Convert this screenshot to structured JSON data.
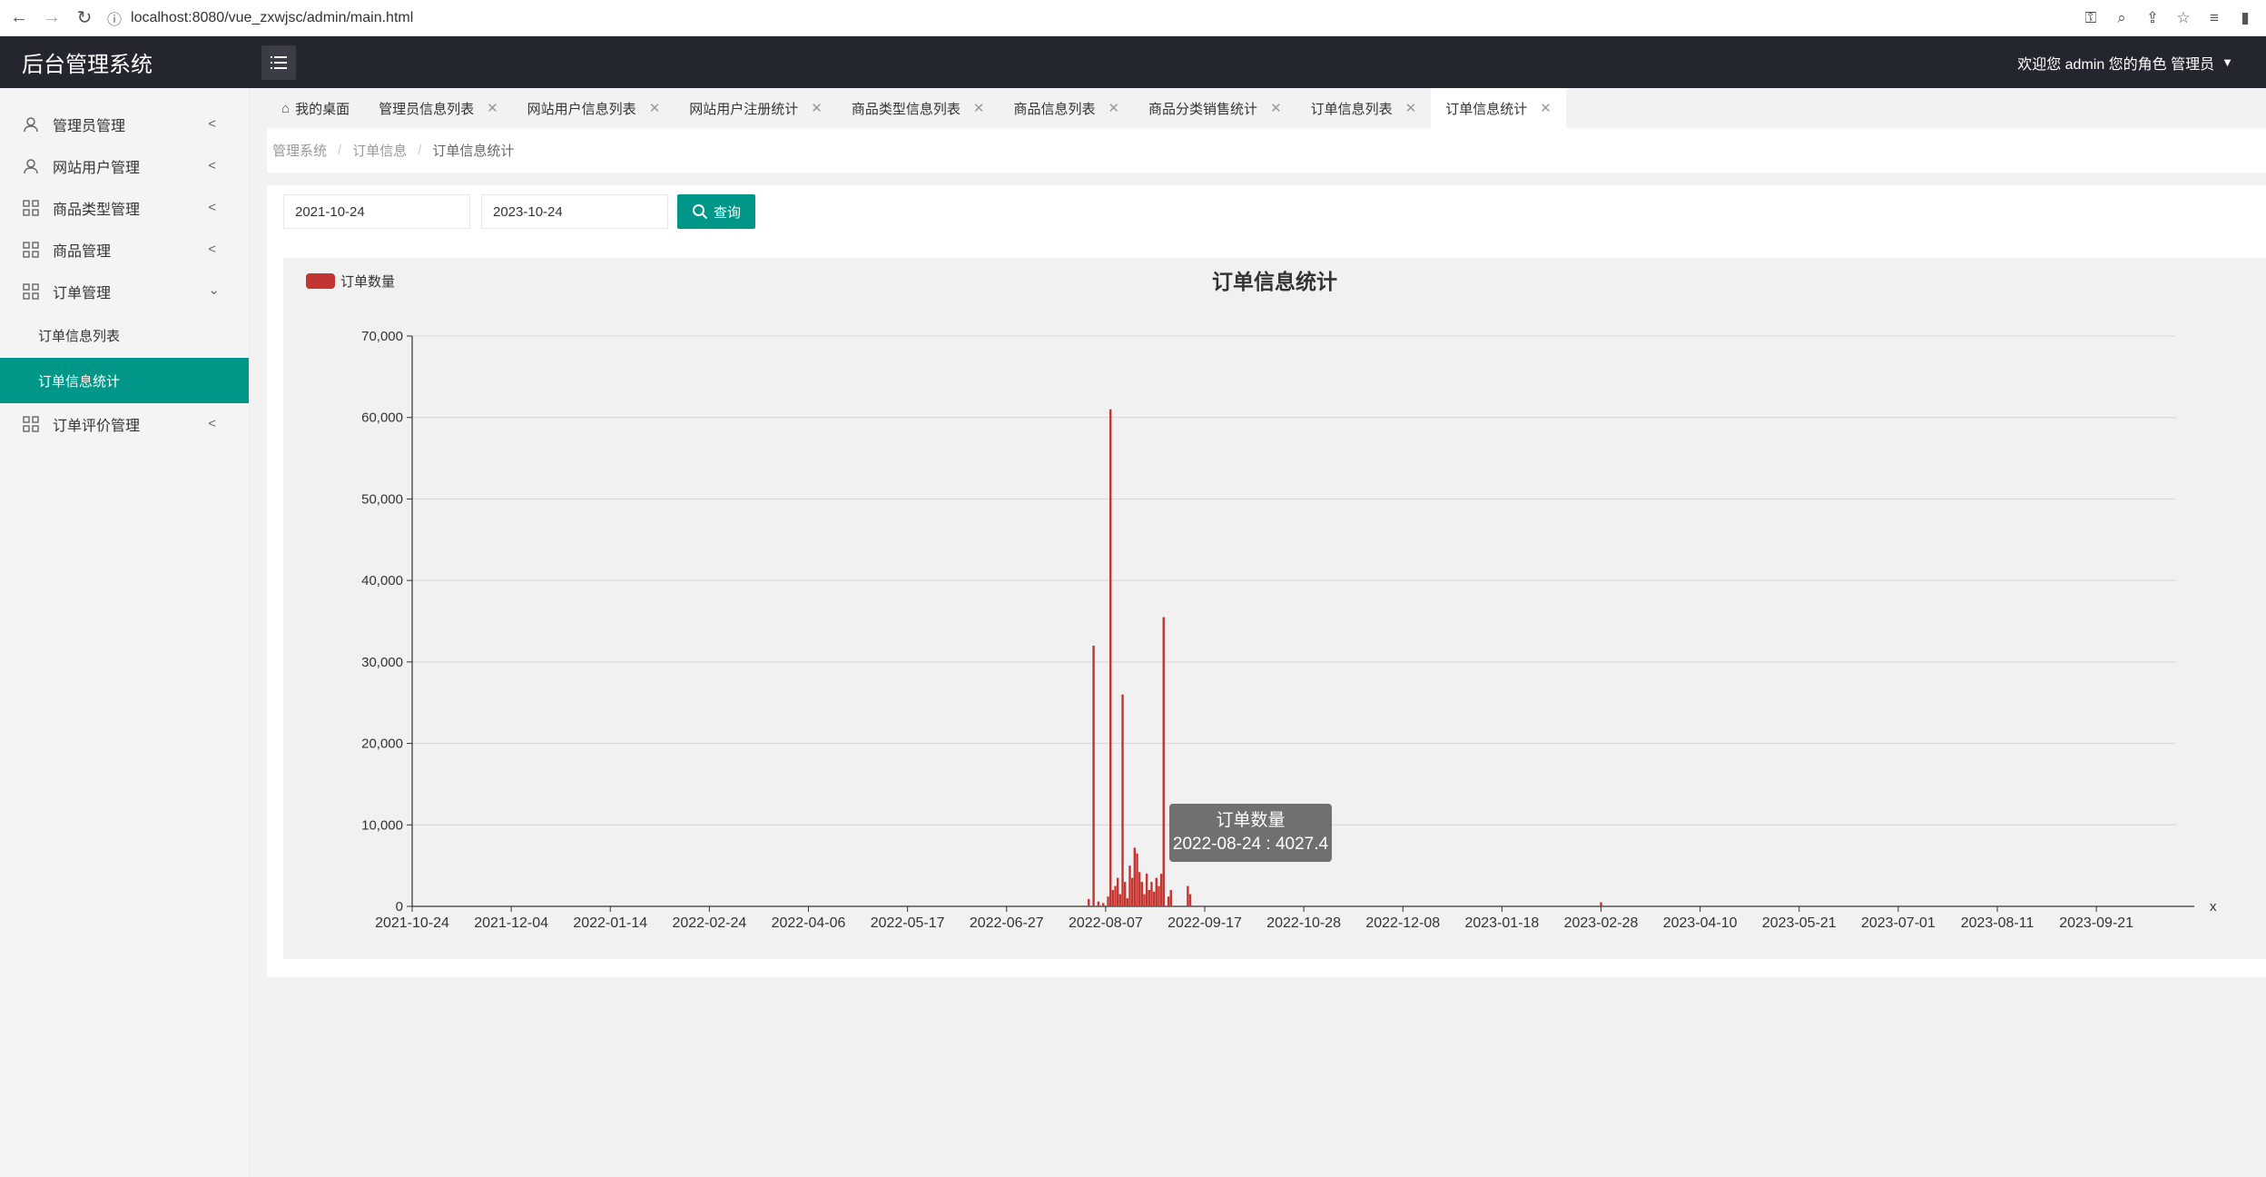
{
  "browser": {
    "url": "localhost:8080/vue_zxwjsc/admin/main.html"
  },
  "header": {
    "title": "后台管理系统",
    "user_text": "欢迎您 admin 您的角色 管理员"
  },
  "sidebar": {
    "items": [
      {
        "label": "管理员管理",
        "icon": "user-icon"
      },
      {
        "label": "网站用户管理",
        "icon": "user-icon"
      },
      {
        "label": "商品类型管理",
        "icon": "grid-icon"
      },
      {
        "label": "商品管理",
        "icon": "grid-icon"
      },
      {
        "label": "订单管理",
        "icon": "grid-icon"
      },
      {
        "label": "订单评价管理",
        "icon": "grid-icon"
      }
    ],
    "subitems": [
      {
        "label": "订单信息列表"
      },
      {
        "label": "订单信息统计"
      }
    ]
  },
  "tabs": [
    {
      "label": "我的桌面"
    },
    {
      "label": "管理员信息列表"
    },
    {
      "label": "网站用户信息列表"
    },
    {
      "label": "网站用户注册统计"
    },
    {
      "label": "商品类型信息列表"
    },
    {
      "label": "商品信息列表"
    },
    {
      "label": "商品分类销售统计"
    },
    {
      "label": "订单信息列表"
    },
    {
      "label": "订单信息统计"
    }
  ],
  "breadcrumb": [
    "管理系统",
    "订单信息",
    "订单信息统计"
  ],
  "filter": {
    "start_date": "2021-10-24",
    "end_date": "2023-10-24",
    "query_label": "查询"
  },
  "tooltip": {
    "title": "订单数量",
    "text": "2022-08-24 : 4027.4"
  },
  "colors": {
    "accent": "#009688",
    "header_bg": "#23262e",
    "bar": "#c23531"
  },
  "chart_data": {
    "type": "bar",
    "title": "订单信息统计",
    "legend": [
      "订单数量"
    ],
    "legend_position": "top-left",
    "xlabel": "x",
    "ylabel": "",
    "ylim": [
      0,
      70000
    ],
    "yticks": [
      "0",
      "10,000",
      "20,000",
      "30,000",
      "40,000",
      "50,000",
      "60,000",
      "70,000"
    ],
    "xticks": [
      "2021-10-24",
      "2021-12-04",
      "2022-01-14",
      "2022-02-24",
      "2022-04-06",
      "2022-05-17",
      "2022-06-27",
      "2022-08-07",
      "2022-09-17",
      "2022-10-28",
      "2022-12-08",
      "2023-01-18",
      "2023-02-28",
      "2023-04-10",
      "2023-05-21",
      "2023-07-01",
      "2023-08-11",
      "2023-09-21"
    ],
    "x_start": "2021-10-24",
    "x_end": "2023-10-24",
    "grid": true,
    "series": [
      {
        "name": "订单数量",
        "points": [
          [
            "2022-07-31",
            900
          ],
          [
            "2022-08-02",
            32000
          ],
          [
            "2022-08-04",
            600
          ],
          [
            "2022-08-06",
            400
          ],
          [
            "2022-08-08",
            1200
          ],
          [
            "2022-08-09",
            61000
          ],
          [
            "2022-08-10",
            2000
          ],
          [
            "2022-08-11",
            2500
          ],
          [
            "2022-08-12",
            3500
          ],
          [
            "2022-08-13",
            1500
          ],
          [
            "2022-08-14",
            26000
          ],
          [
            "2022-08-15",
            3000
          ],
          [
            "2022-08-16",
            1000
          ],
          [
            "2022-08-17",
            5000
          ],
          [
            "2022-08-18",
            3500
          ],
          [
            "2022-08-19",
            7200
          ],
          [
            "2022-08-20",
            6500
          ],
          [
            "2022-08-21",
            4200
          ],
          [
            "2022-08-22",
            3000
          ],
          [
            "2022-08-23",
            1500
          ],
          [
            "2022-08-24",
            4027.4
          ],
          [
            "2022-08-25",
            2000
          ],
          [
            "2022-08-26",
            3000
          ],
          [
            "2022-08-27",
            1800
          ],
          [
            "2022-08-28",
            3500
          ],
          [
            "2022-08-29",
            2500
          ],
          [
            "2022-08-30",
            4000
          ],
          [
            "2022-08-31",
            35500
          ],
          [
            "2022-09-02",
            1200
          ],
          [
            "2022-09-03",
            2000
          ],
          [
            "2022-09-10",
            2500
          ],
          [
            "2022-09-11",
            1500
          ],
          [
            "2023-02-28",
            500
          ]
        ]
      }
    ]
  }
}
